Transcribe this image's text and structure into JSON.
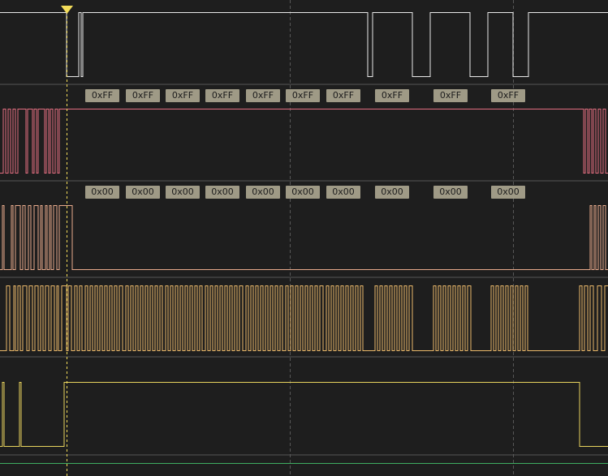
{
  "palette": {
    "background": "#1e1e1e",
    "divider": "#3a3a3a",
    "grid": "#585858",
    "cursor": "#f2dc5a",
    "channel0": "#e8e8e8",
    "channel1": "#e36d80",
    "channel2": "#e8ab8c",
    "channel3": "#ebb86a",
    "channel4": "#e8d35e",
    "timebase": "#3fae62",
    "badge_bg": "#9f9a86",
    "badge_text": "#1c1c1c"
  },
  "cursor": {
    "icon": "trigger-marker-icon"
  },
  "decoder": {
    "row1_label_texts": [
      "0xFF",
      "0xFF",
      "0xFF",
      "0xFF",
      "0xFF",
      "0xFF",
      "0xFF",
      "0xFF",
      "0xFF",
      "0xFF"
    ],
    "row2_label_texts": [
      "0x00",
      "0x00",
      "0x00",
      "0x00",
      "0x00",
      "0x00",
      "0x00",
      "0x00",
      "0x00",
      "0x00"
    ]
  }
}
